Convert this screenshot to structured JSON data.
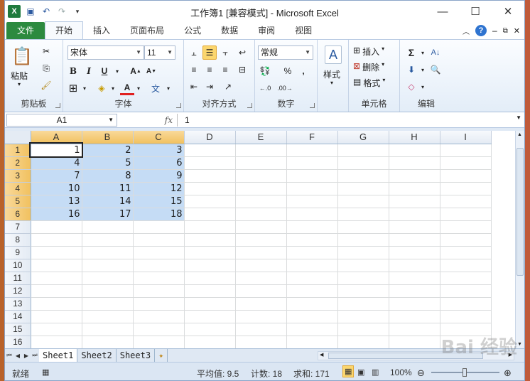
{
  "window": {
    "title": "工作簿1  [兼容模式]  -  Microsoft Excel",
    "qat_icons": [
      "excel-logo",
      "save-icon",
      "undo-icon",
      "redo-icon"
    ]
  },
  "tabs": [
    "文件",
    "开始",
    "插入",
    "页面布局",
    "公式",
    "数据",
    "审阅",
    "视图"
  ],
  "ribbon": {
    "clipboard": {
      "label": "剪贴板",
      "paste": "粘贴"
    },
    "font": {
      "label": "字体",
      "name": "宋体",
      "size": "11",
      "bold": "B",
      "italic": "I",
      "underline": "U"
    },
    "alignment": {
      "label": "对齐方式"
    },
    "number": {
      "label": "数字",
      "format": "常规",
      "percent": "%",
      "comma": ","
    },
    "styles": {
      "label": "样式"
    },
    "cells": {
      "label": "单元格",
      "insert": "插入",
      "delete": "删除",
      "format": "格式"
    },
    "editing": {
      "label": "编辑",
      "sum": "Σ"
    }
  },
  "formula_bar": {
    "name_box": "A1",
    "fx": "fx",
    "value": "1"
  },
  "sheet": {
    "columns": [
      "A",
      "B",
      "C",
      "D",
      "E",
      "F",
      "G",
      "H",
      "I"
    ],
    "rows": [
      "1",
      "2",
      "3",
      "4",
      "5",
      "6",
      "7",
      "8",
      "9",
      "10",
      "11",
      "12",
      "13",
      "14",
      "15",
      "16"
    ],
    "data": [
      [
        "1",
        "2",
        "3"
      ],
      [
        "4",
        "5",
        "6"
      ],
      [
        "7",
        "8",
        "9"
      ],
      [
        "10",
        "11",
        "12"
      ],
      [
        "13",
        "14",
        "15"
      ],
      [
        "16",
        "17",
        "18"
      ]
    ]
  },
  "sheet_tabs": [
    "Sheet1",
    "Sheet2",
    "Sheet3"
  ],
  "status": {
    "mode": "就绪",
    "average": "平均值: 9.5",
    "count": "计数: 18",
    "sum": "求和: 171",
    "zoom": "100%"
  },
  "colors": {
    "accent": "#2c8a3f",
    "selection": "#c5dcf5",
    "header_selected": "#f1c15f"
  }
}
